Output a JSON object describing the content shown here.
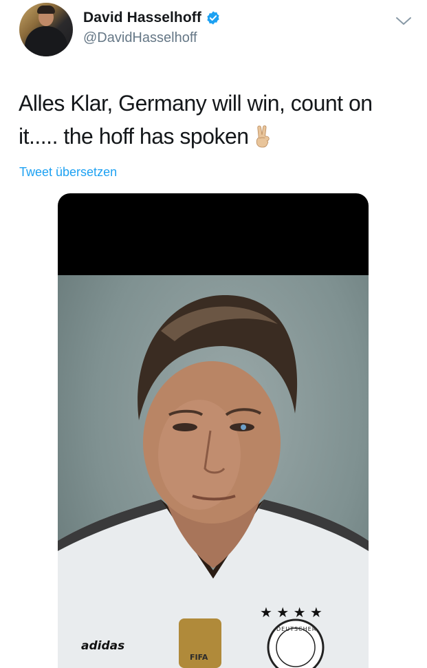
{
  "tweet": {
    "author": {
      "display_name": "David Hasselhoff",
      "handle": "@DavidHasselhoff",
      "verified": true
    },
    "text": "Alles Klar, Germany will win, count on it..... the hoff has spoken",
    "emoji": "victory-hand-emoji",
    "translate_label": "Tweet übersetzen",
    "media": {
      "description_icon": "photo",
      "jersey_brand": "adidas",
      "badge_text": "FIFA",
      "crest_text": "DEUTSCHER"
    }
  },
  "colors": {
    "link": "#1da1f2",
    "handle": "#657786",
    "text": "#14171a",
    "verified": "#1da1f2"
  }
}
